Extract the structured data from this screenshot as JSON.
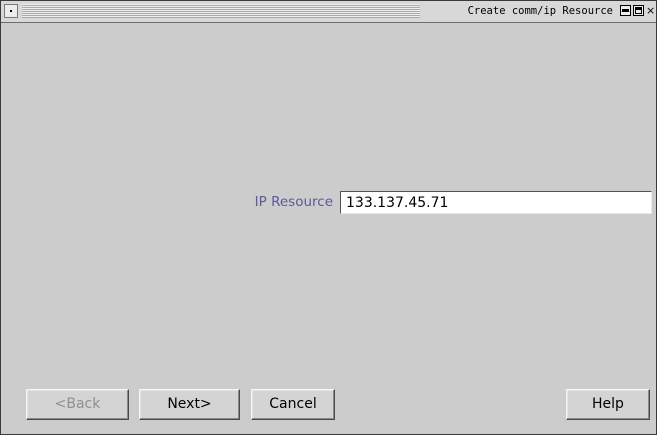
{
  "window": {
    "title": "Create comm/ip Resource",
    "close_glyph": "×"
  },
  "form": {
    "label": "IP Resource",
    "value": "133.137.45.71"
  },
  "buttons": {
    "back": "<Back",
    "next": "Next>",
    "cancel": "Cancel",
    "help": "Help"
  },
  "colors": {
    "background": "#cccccc",
    "label": "#5a5a9a",
    "disabled_text": "#8f8f8f"
  }
}
